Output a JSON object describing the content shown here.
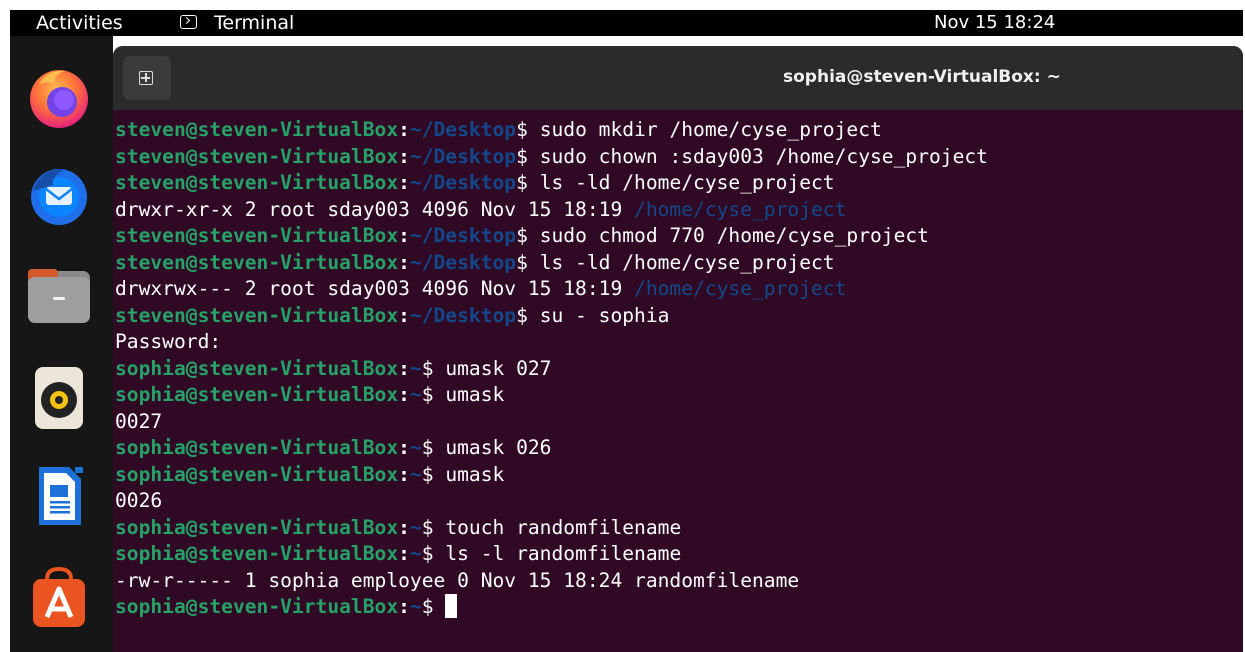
{
  "topbar": {
    "activities": "Activities",
    "app_name": "Terminal",
    "clock": "Nov 15  18:24"
  },
  "dock": {
    "items": [
      "firefox-icon",
      "thunderbird-icon",
      "files-icon",
      "rhythmbox-icon",
      "libreoffice-writer-icon",
      "app-center-icon"
    ]
  },
  "terminal": {
    "title": "sophia@steven-VirtualBox: ~",
    "lines": [
      {
        "user": "steven@steven-VirtualBox",
        "path": "~/Desktop",
        "cmd": "sudo mkdir /home/cyse_project"
      },
      {
        "user": "steven@steven-VirtualBox",
        "path": "~/Desktop",
        "cmd": "sudo chown :sday003 /home/cyse_project"
      },
      {
        "user": "steven@steven-VirtualBox",
        "path": "~/Desktop",
        "cmd": "ls -ld /home/cyse_project"
      },
      {
        "text": "drwxr-xr-x 2 root sday003 4096 Nov 15 18:19 ",
        "dir": "/home/cyse_project"
      },
      {
        "user": "steven@steven-VirtualBox",
        "path": "~/Desktop",
        "cmd": "sudo chmod 770 /home/cyse_project"
      },
      {
        "user": "steven@steven-VirtualBox",
        "path": "~/Desktop",
        "cmd": "ls -ld /home/cyse_project"
      },
      {
        "text": "drwxrwx--- 2 root sday003 4096 Nov 15 18:19 ",
        "dir": "/home/cyse_project"
      },
      {
        "user": "steven@steven-VirtualBox",
        "path": "~/Desktop",
        "cmd": "su - sophia"
      },
      {
        "text": "Password:"
      },
      {
        "user": "sophia@steven-VirtualBox",
        "path": "~",
        "cmd": "umask 027"
      },
      {
        "user": "sophia@steven-VirtualBox",
        "path": "~",
        "cmd": "umask"
      },
      {
        "text": "0027"
      },
      {
        "user": "sophia@steven-VirtualBox",
        "path": "~",
        "cmd": "umask 026"
      },
      {
        "user": "sophia@steven-VirtualBox",
        "path": "~",
        "cmd": "umask"
      },
      {
        "text": "0026"
      },
      {
        "user": "sophia@steven-VirtualBox",
        "path": "~",
        "cmd": "touch randomfilename"
      },
      {
        "user": "sophia@steven-VirtualBox",
        "path": "~",
        "cmd": "ls -l randomfilename"
      },
      {
        "text": "-rw-r----- 1 sophia employee 0 Nov 15 18:24 randomfilename"
      },
      {
        "user": "sophia@steven-VirtualBox",
        "path": "~",
        "cmd": "",
        "cursor": true
      }
    ]
  },
  "colors": {
    "terminal_bg": "#300a24",
    "prompt_user": "#26a269",
    "prompt_path": "#12488b",
    "headerbar": "#2b2b2b",
    "topbar": "#000000",
    "dock": "#161616"
  }
}
